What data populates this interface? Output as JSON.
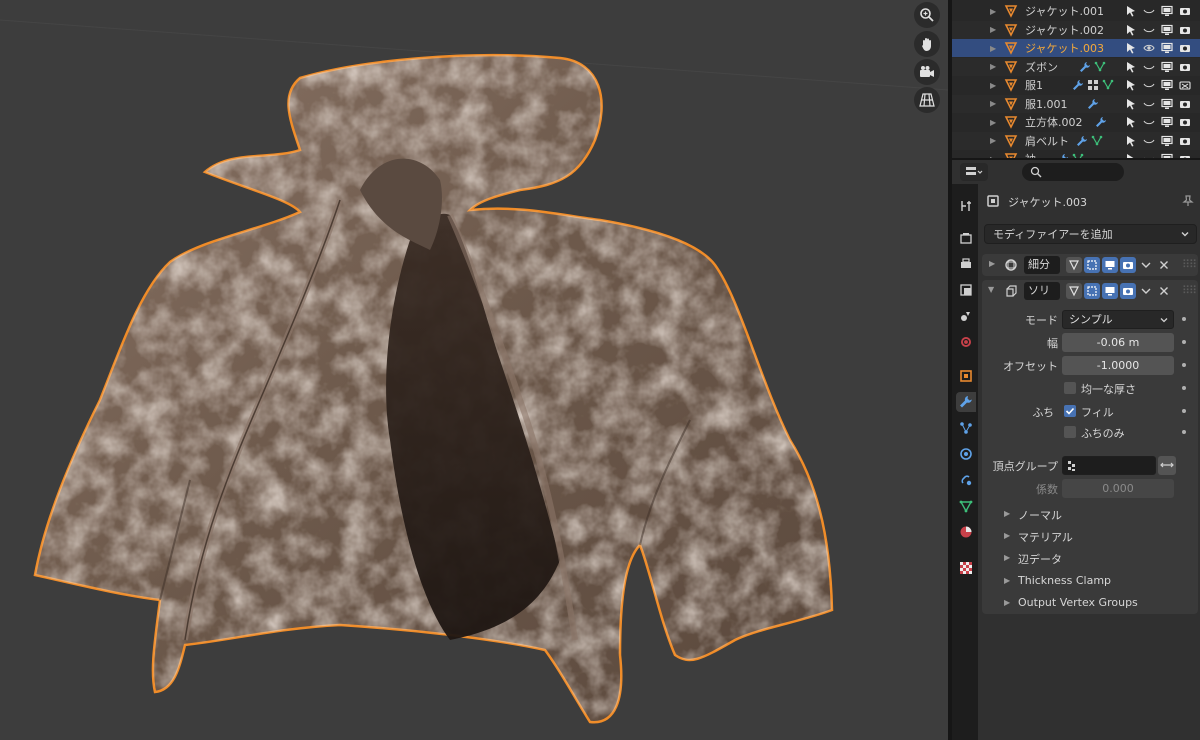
{
  "outliner": {
    "rows": [
      {
        "name": "ジャケット.001",
        "selected": false,
        "visible": false,
        "render_disabled": false
      },
      {
        "name": "ジャケット.002",
        "selected": false,
        "visible": false,
        "render_disabled": false
      },
      {
        "name": "ジャケット.003",
        "selected": true,
        "visible": true,
        "render_disabled": false
      },
      {
        "name": "ズボン",
        "selected": false,
        "visible": false,
        "render_disabled": false
      },
      {
        "name": "服1",
        "selected": false,
        "visible": false,
        "render_disabled": true
      },
      {
        "name": "服1.001",
        "selected": false,
        "visible": false,
        "render_disabled": false
      },
      {
        "name": "立方体.002",
        "selected": false,
        "visible": false,
        "render_disabled": false
      },
      {
        "name": "肩ベルト",
        "selected": false,
        "visible": false,
        "render_disabled": false
      },
      {
        "name": "袖",
        "selected": false,
        "visible": false,
        "render_disabled": false
      }
    ]
  },
  "properties": {
    "object_name": "ジャケット.003",
    "add_modifier_label": "モディファイアーを追加",
    "modifiers": [
      {
        "name": "細分",
        "expanded": false
      },
      {
        "name": "ソリ",
        "expanded": true
      }
    ],
    "solidify": {
      "mode_label": "モード",
      "mode_value": "シンプル",
      "thickness_label": "幅",
      "thickness_value": "-0.06 m",
      "offset_label": "オフセット",
      "offset_value": "-1.0000",
      "even_thickness_label": "均一な厚さ",
      "rim_label": "ふち",
      "fill_label": "フィル",
      "rim_only_label": "ふちのみ",
      "vertex_group_label": "頂点グループ",
      "factor_label": "係数",
      "factor_value": "0.000",
      "subpanels": [
        "ノーマル",
        "マテリアル",
        "辺データ",
        "Thickness Clamp",
        "Output Vertex Groups"
      ]
    }
  },
  "colors": {
    "accent": "#4772b3",
    "selection_outline": "#f08c28",
    "object_name_selected": "#f5a93a"
  }
}
